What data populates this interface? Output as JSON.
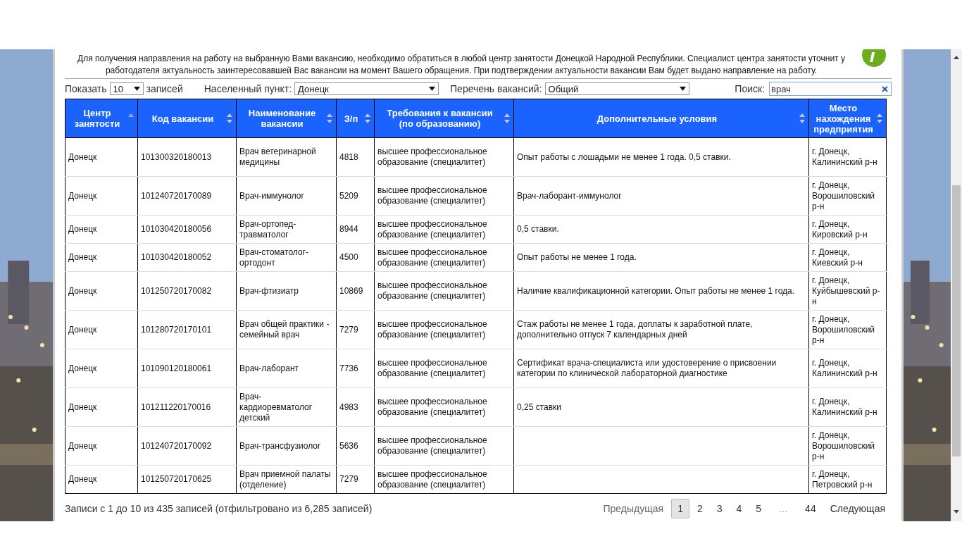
{
  "notice": "Для получения направления на работу на выбранную Вами вакансию, необходимо обратиться в любой центр занятости Донецкой Народной Республики. Специалист центра занятости уточнит у работодателя актуальность заинтересовавшей Вас вакансии на момент Вашего обращения. При подтверждении актуальности вакансии Вам будет выдано направление на работу.",
  "controls": {
    "show_label": "Показать",
    "show_value": "10",
    "show_suffix": "записей",
    "city_label": "Населенный пункт:",
    "city_value": "Донецк",
    "list_label": "Перечень вакансий:",
    "list_value": "Общий",
    "search_label": "Поиск:",
    "search_value": "врач"
  },
  "table": {
    "columns": [
      {
        "label": "Центр занятости",
        "sorted": true
      },
      {
        "label": "Код вакансии",
        "sorted": false
      },
      {
        "label": "Наименование вакансии",
        "sorted": false
      },
      {
        "label": "З/п",
        "sorted": false
      },
      {
        "label": "Требования к вакансии (по образованию)",
        "sorted": false
      },
      {
        "label": "Дополнительные условия",
        "sorted": false
      },
      {
        "label": "Место нахождения предприятия",
        "sorted": false
      }
    ],
    "rows": [
      [
        "Донецк",
        "101300320180013",
        "Врач ветеринарной медицины",
        "4818",
        "высшее профессиональное образование (специалитет)",
        "Опыт работы с лошадьми не менее 1 года. 0,5 ставки.",
        "г. Донецк, Калининский р-н"
      ],
      [
        "Донецк",
        "101240720170089",
        "Врач-иммунолог",
        "5209",
        "высшее профессиональное образование (специалитет)",
        "Врач-лаборант-иммунолог",
        "г. Донецк, Ворошиловский р-н"
      ],
      [
        "Донецк",
        "101030420180056",
        "Врач-ортопед-травматолог",
        "8944",
        "высшее профессиональное образование (специалитет)",
        "0,5 ставки.",
        "г. Донецк, Кировский р-н"
      ],
      [
        "Донецк",
        "101030420180052",
        "Врач-стоматолог-ортодонт",
        "4500",
        "высшее профессиональное образование (специалитет)",
        "Опыт работы не менее 1 года.",
        "г. Донецк, Киевский р-н"
      ],
      [
        "Донецк",
        "101250720170082",
        "Врач-фтизиатр",
        "10869",
        "высшее профессиональное образование (специалитет)",
        "Наличие квалификационной категории. Опыт работы не менее 1 года.",
        "г. Донецк, Куйбышевский р-н"
      ],
      [
        "Донецк",
        "101280720170101",
        "Врач общей практики - семейный врач",
        "7279",
        "высшее профессиональное образование (специалитет)",
        "Стаж работы не менее 1 года, доплаты к заработной плате, дополнительно отпуск 7 календарных дней",
        "г. Донецк, Ворошиловский р-н"
      ],
      [
        "Донецк",
        "101090120180061",
        "Врач-лаборант",
        "7736",
        "высшее профессиональное образование (специалитет)",
        "Сертификат врача-специалиста или удостоверение о присвоении категории по клинической лабораторной диагностике",
        "г. Донецк, Калининский р-н"
      ],
      [
        "Донецк",
        "101211220170016",
        "Врач-кардиоревматолог детский",
        "4983",
        "высшее профессиональное образование (специалитет)",
        "0,25 ставки",
        "г. Донецк, Калининский р-н"
      ],
      [
        "Донецк",
        "101240720170092",
        "Врач-трансфузиолог",
        "5636",
        "высшее профессиональное образование (специалитет)",
        "",
        "г. Донецк, Ворошиловский р-н"
      ],
      [
        "Донецк",
        "101250720170625",
        "Врач приемной палаты (отделение)",
        "7279",
        "высшее профессиональное образование (специалитет)",
        "",
        "г. Донецк, Петровский р-н"
      ]
    ]
  },
  "info": "Записи с 1 до 10 из 435 записей (отфильтровано из 6,285 записей)",
  "pagination": {
    "previous": "Предыдущая",
    "next": "Следующая",
    "pages": [
      {
        "label": "1",
        "selected": true
      },
      {
        "label": "2",
        "selected": false
      },
      {
        "label": "3",
        "selected": false
      },
      {
        "label": "4",
        "selected": false
      },
      {
        "label": "5",
        "selected": false
      },
      {
        "label": "…",
        "kind": "ellipsis"
      },
      {
        "label": "44",
        "selected": false
      }
    ]
  }
}
